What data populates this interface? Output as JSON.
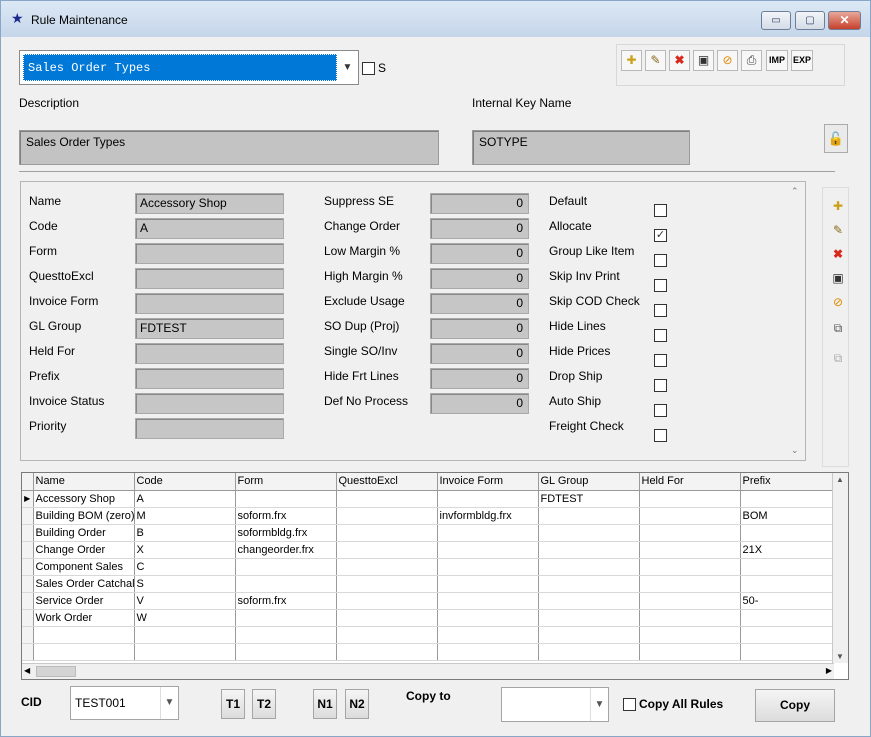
{
  "window": {
    "title": "Rule Maintenance",
    "controls": {
      "minimize": "▭",
      "maximize": "▢",
      "close": "✕"
    }
  },
  "header": {
    "rule_type": "Sales Order Types",
    "s_label": "S",
    "s_checked": false,
    "description_label": "Description",
    "description_value": "Sales Order Types",
    "internal_key_label": "Internal Key Name",
    "internal_key_value": "SOTYPE"
  },
  "toolbar": {
    "imp_label": "IMP",
    "exp_label": "EXP",
    "icons": [
      "new-icon",
      "edit-icon",
      "delete-icon",
      "save-icon",
      "cancel-icon",
      "print-icon"
    ]
  },
  "form": {
    "col1": [
      {
        "label": "Name",
        "value": "Accessory Shop"
      },
      {
        "label": "Code",
        "value": "A"
      },
      {
        "label": "Form",
        "value": ""
      },
      {
        "label": "QuesttoExcl",
        "value": ""
      },
      {
        "label": "Invoice Form",
        "value": ""
      },
      {
        "label": "GL Group",
        "value": "FDTEST"
      },
      {
        "label": "Held For",
        "value": ""
      },
      {
        "label": "Prefix",
        "value": ""
      },
      {
        "label": "Invoice Status",
        "value": ""
      },
      {
        "label": "Priority",
        "value": ""
      }
    ],
    "col2": [
      {
        "label": "Suppress SE",
        "value": "0"
      },
      {
        "label": "Change Order",
        "value": "0"
      },
      {
        "label": "Low Margin %",
        "value": "0"
      },
      {
        "label": "High Margin %",
        "value": "0"
      },
      {
        "label": "Exclude Usage",
        "value": "0"
      },
      {
        "label": "SO Dup (Proj)",
        "value": "0"
      },
      {
        "label": "Single SO/Inv",
        "value": "0"
      },
      {
        "label": "Hide Frt Lines",
        "value": "0"
      },
      {
        "label": "Def No Process",
        "value": "0"
      }
    ],
    "col3": [
      {
        "label": "Default",
        "checked": false
      },
      {
        "label": "Allocate",
        "checked": true
      },
      {
        "label": "Group Like Item",
        "checked": false
      },
      {
        "label": "Skip Inv Print",
        "checked": false
      },
      {
        "label": "Skip COD Check",
        "checked": false
      },
      {
        "label": "Hide Lines",
        "checked": false
      },
      {
        "label": "Hide Prices",
        "checked": false
      },
      {
        "label": "Drop Ship",
        "checked": false
      },
      {
        "label": "Auto Ship",
        "checked": false
      },
      {
        "label": "Freight Check",
        "checked": false
      }
    ]
  },
  "grid": {
    "columns": [
      "Name",
      "Code",
      "Form",
      "QuesttoExcl",
      "Invoice Form",
      "GL Group",
      "Held For",
      "Prefix"
    ],
    "rows": [
      [
        "Accessory Shop",
        "A",
        "",
        "",
        "",
        "FDTEST",
        "",
        ""
      ],
      [
        "Building BOM (zero)",
        "M",
        "soform.frx",
        "",
        "invformbldg.frx",
        "",
        "",
        "BOM"
      ],
      [
        "Building Order",
        "B",
        "soformbldg.frx",
        "",
        "",
        "",
        "",
        ""
      ],
      [
        "Change Order",
        "X",
        "changeorder.frx",
        "",
        "",
        "",
        "",
        "21X"
      ],
      [
        "Component Sales",
        "C",
        "",
        "",
        "",
        "",
        "",
        ""
      ],
      [
        "Sales Order Catchall",
        "S",
        "",
        "",
        "",
        "",
        "",
        ""
      ],
      [
        "Service Order",
        "V",
        "soform.frx",
        "",
        "",
        "",
        "",
        "50-"
      ],
      [
        "Work Order",
        "W",
        "",
        "",
        "",
        "",
        "",
        ""
      ],
      [
        "",
        "",
        "",
        "",
        "",
        "",
        "",
        ""
      ],
      [
        "",
        "",
        "",
        "",
        "",
        "",
        "",
        ""
      ]
    ],
    "current_row_marker": "▶"
  },
  "bottom": {
    "cid_label": "CID",
    "cid_value": "TEST001",
    "t1": "T1",
    "t2": "T2",
    "n1": "N1",
    "n2": "N2",
    "copy_to_label": "Copy to",
    "copy_to_value": "",
    "copy_all_label": "Copy All Rules",
    "copy_all_checked": false,
    "copy_button": "Copy"
  },
  "colors": {
    "selection": "#0078d7",
    "field_bg": "#c6c6c6",
    "delete_red": "#d9281c",
    "lock_green": "#127a3a"
  }
}
